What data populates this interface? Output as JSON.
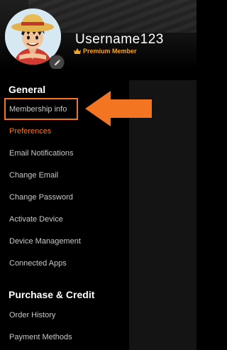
{
  "profile": {
    "username": "Username123",
    "membership_label": "Premium Member"
  },
  "colors": {
    "accent": "#f47521",
    "premium": "#f5a623",
    "background": "#000000",
    "panel": "#141414"
  },
  "sections": {
    "general": {
      "title": "General",
      "items": [
        {
          "label": "Membership info"
        },
        {
          "label": "Preferences"
        },
        {
          "label": "Email Notifications"
        },
        {
          "label": "Change Email"
        },
        {
          "label": "Change Password"
        },
        {
          "label": "Activate Device"
        },
        {
          "label": "Device Management"
        },
        {
          "label": "Connected Apps"
        }
      ]
    },
    "purchase": {
      "title": "Purchase & Credit",
      "items": [
        {
          "label": "Order History"
        },
        {
          "label": "Payment Methods"
        }
      ]
    }
  },
  "icons": {
    "edit": "pencil-icon",
    "crown": "crown-icon",
    "annotation_arrow": "arrow-left-icon"
  }
}
